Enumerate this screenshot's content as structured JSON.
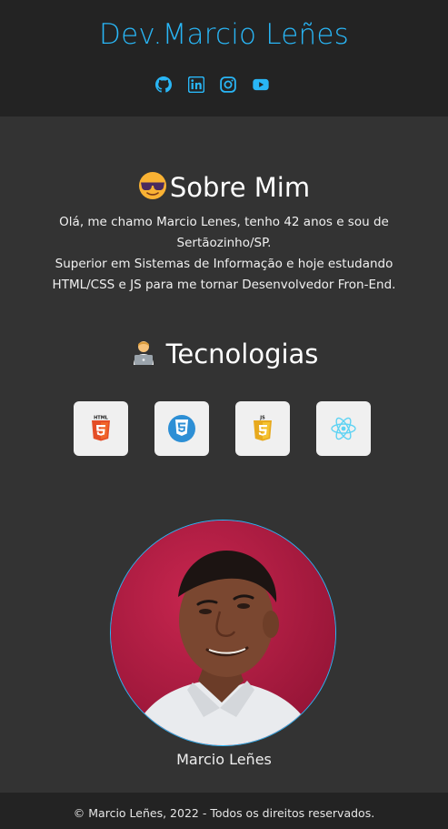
{
  "header": {
    "title": "Dev.Marcio Leñes",
    "accent_color": "#29b6f6",
    "socials": [
      {
        "icon": "github-icon"
      },
      {
        "icon": "linkedin-icon"
      },
      {
        "icon": "instagram-icon"
      },
      {
        "icon": "youtube-icon"
      }
    ]
  },
  "about": {
    "emoji": "smiling-face-with-sunglasses-icon",
    "title": "Sobre Mim",
    "lines": [
      "Olá, me chamo Marcio Lenes, tenho 42 anos e sou de Sertãozinho/SP.",
      "Superior em Sistemas de Informação e hoje estudando HTML/CSS e JS para me tornar Desenvolvedor Fron-End."
    ]
  },
  "technologies": {
    "emoji": "technologist-icon",
    "title": "Tecnologias",
    "items": [
      {
        "name": "html5-icon",
        "label": "HTML"
      },
      {
        "name": "css3-icon"
      },
      {
        "name": "javascript-icon",
        "label": "JS"
      },
      {
        "name": "react-icon"
      }
    ]
  },
  "profile": {
    "name": "Marcio Leñes"
  },
  "footer": {
    "text": "© Marcio Leñes, 2022 - Todos os direitos reservados."
  }
}
